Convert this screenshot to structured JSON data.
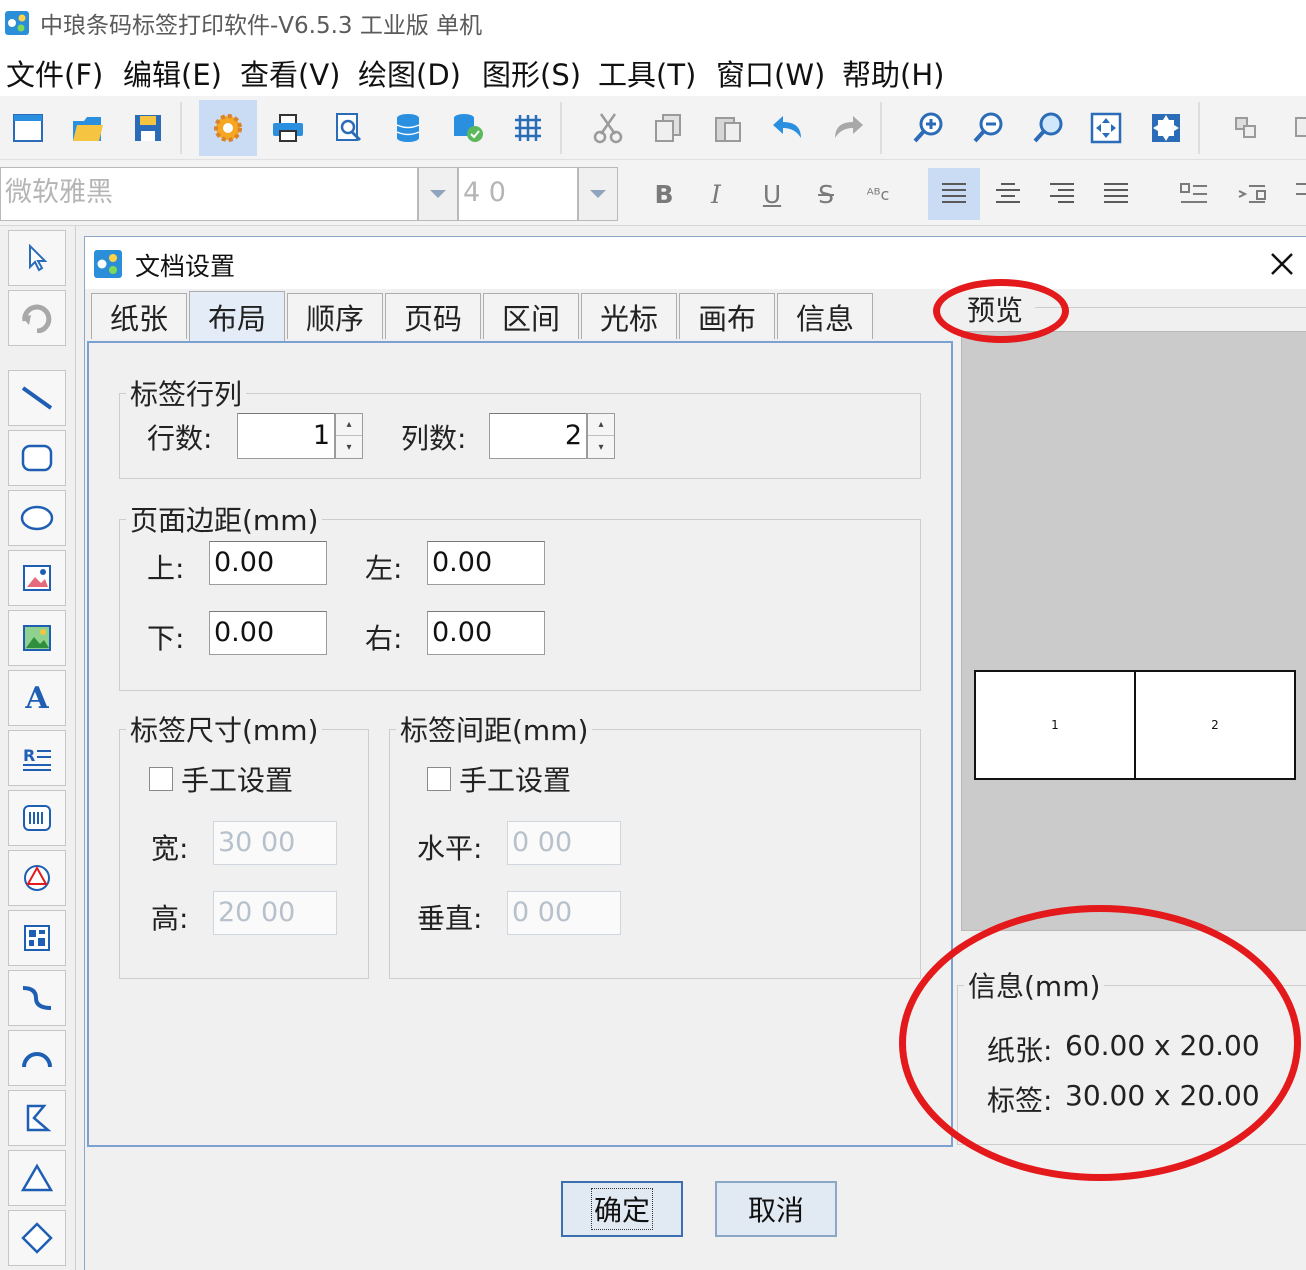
{
  "app": {
    "title": "中琅条码标签打印软件-V6.5.3 工业版 单机"
  },
  "menu": [
    "文件(F)",
    "编辑(E)",
    "查看(V)",
    "绘图(D)",
    "图形(S)",
    "工具(T)",
    "窗口(W)",
    "帮助(H)"
  ],
  "toolbar": {
    "icons": [
      "new-file-icon",
      "open-folder-icon",
      "save-icon",
      "settings-gear-icon",
      "print-icon",
      "print-preview-icon",
      "database-icon",
      "database-connect-icon",
      "grid-icon",
      "cut-icon",
      "copy-icon",
      "paste-icon",
      "undo-icon",
      "redo-icon",
      "zoom-in-icon",
      "zoom-out-icon",
      "zoom-icon",
      "fit-window-icon",
      "actual-size-icon",
      "group-icon",
      "ungroup-icon"
    ],
    "active": "settings-gear-icon"
  },
  "format": {
    "font_name": "微软雅黑",
    "font_size": "4 0",
    "buttons": {
      "bold": "B",
      "italic": "I",
      "underline": "U",
      "strike": "S",
      "sup": "ᴬᴮc"
    }
  },
  "palette": [
    "pointer-icon",
    "rotate-icon",
    "line-icon",
    "rounded-rect-icon",
    "ellipse-icon",
    "image-icon",
    "picture-icon",
    "text-icon",
    "rich-text-icon",
    "barcode-icon",
    "shape-icon",
    "qrcode-icon",
    "curve-icon",
    "arc-icon",
    "polygon-icon",
    "triangle-icon",
    "diamond-icon"
  ],
  "dialog": {
    "title": "文档设置",
    "tabs": [
      "纸张",
      "布局",
      "顺序",
      "页码",
      "区间",
      "光标",
      "画布",
      "信息"
    ],
    "active_tab": "布局",
    "rows_cols": {
      "legend": "标签行列",
      "rows_label": "行数:",
      "rows_value": "1",
      "cols_label": "列数:",
      "cols_value": "2"
    },
    "margins": {
      "legend": "页面边距(mm)",
      "top_label": "上:",
      "top_value": "0.00",
      "left_label": "左:",
      "left_value": "0.00",
      "bottom_label": "下:",
      "bottom_value": "0.00",
      "right_label": "右:",
      "right_value": "0.00"
    },
    "label_size": {
      "legend": "标签尺寸(mm)",
      "manual_label": "手工设置",
      "manual_checked": false,
      "width_label": "宽:",
      "width_value": "30 00",
      "height_label": "高:",
      "height_value": "20 00"
    },
    "label_gap": {
      "legend": "标签间距(mm)",
      "manual_label": "手工设置",
      "manual_checked": false,
      "horizontal_label": "水平:",
      "horizontal_value": "0 00",
      "vertical_label": "垂直:",
      "vertical_value": "0 00"
    },
    "preview": {
      "legend": "预览",
      "labels": [
        "1",
        "2"
      ]
    },
    "info": {
      "legend": "信息(mm)",
      "paper_label": "纸张:",
      "paper_value": "60.00 x 20.00",
      "label_label": "标签:",
      "label_value": "30.00 x 20.00"
    },
    "ok_label": "确定",
    "cancel_label": "取消"
  },
  "colors": {
    "highlight_circle": "#e3191c",
    "active_tab": "#e3ecf7",
    "panel_border": "#7ca0d0"
  }
}
